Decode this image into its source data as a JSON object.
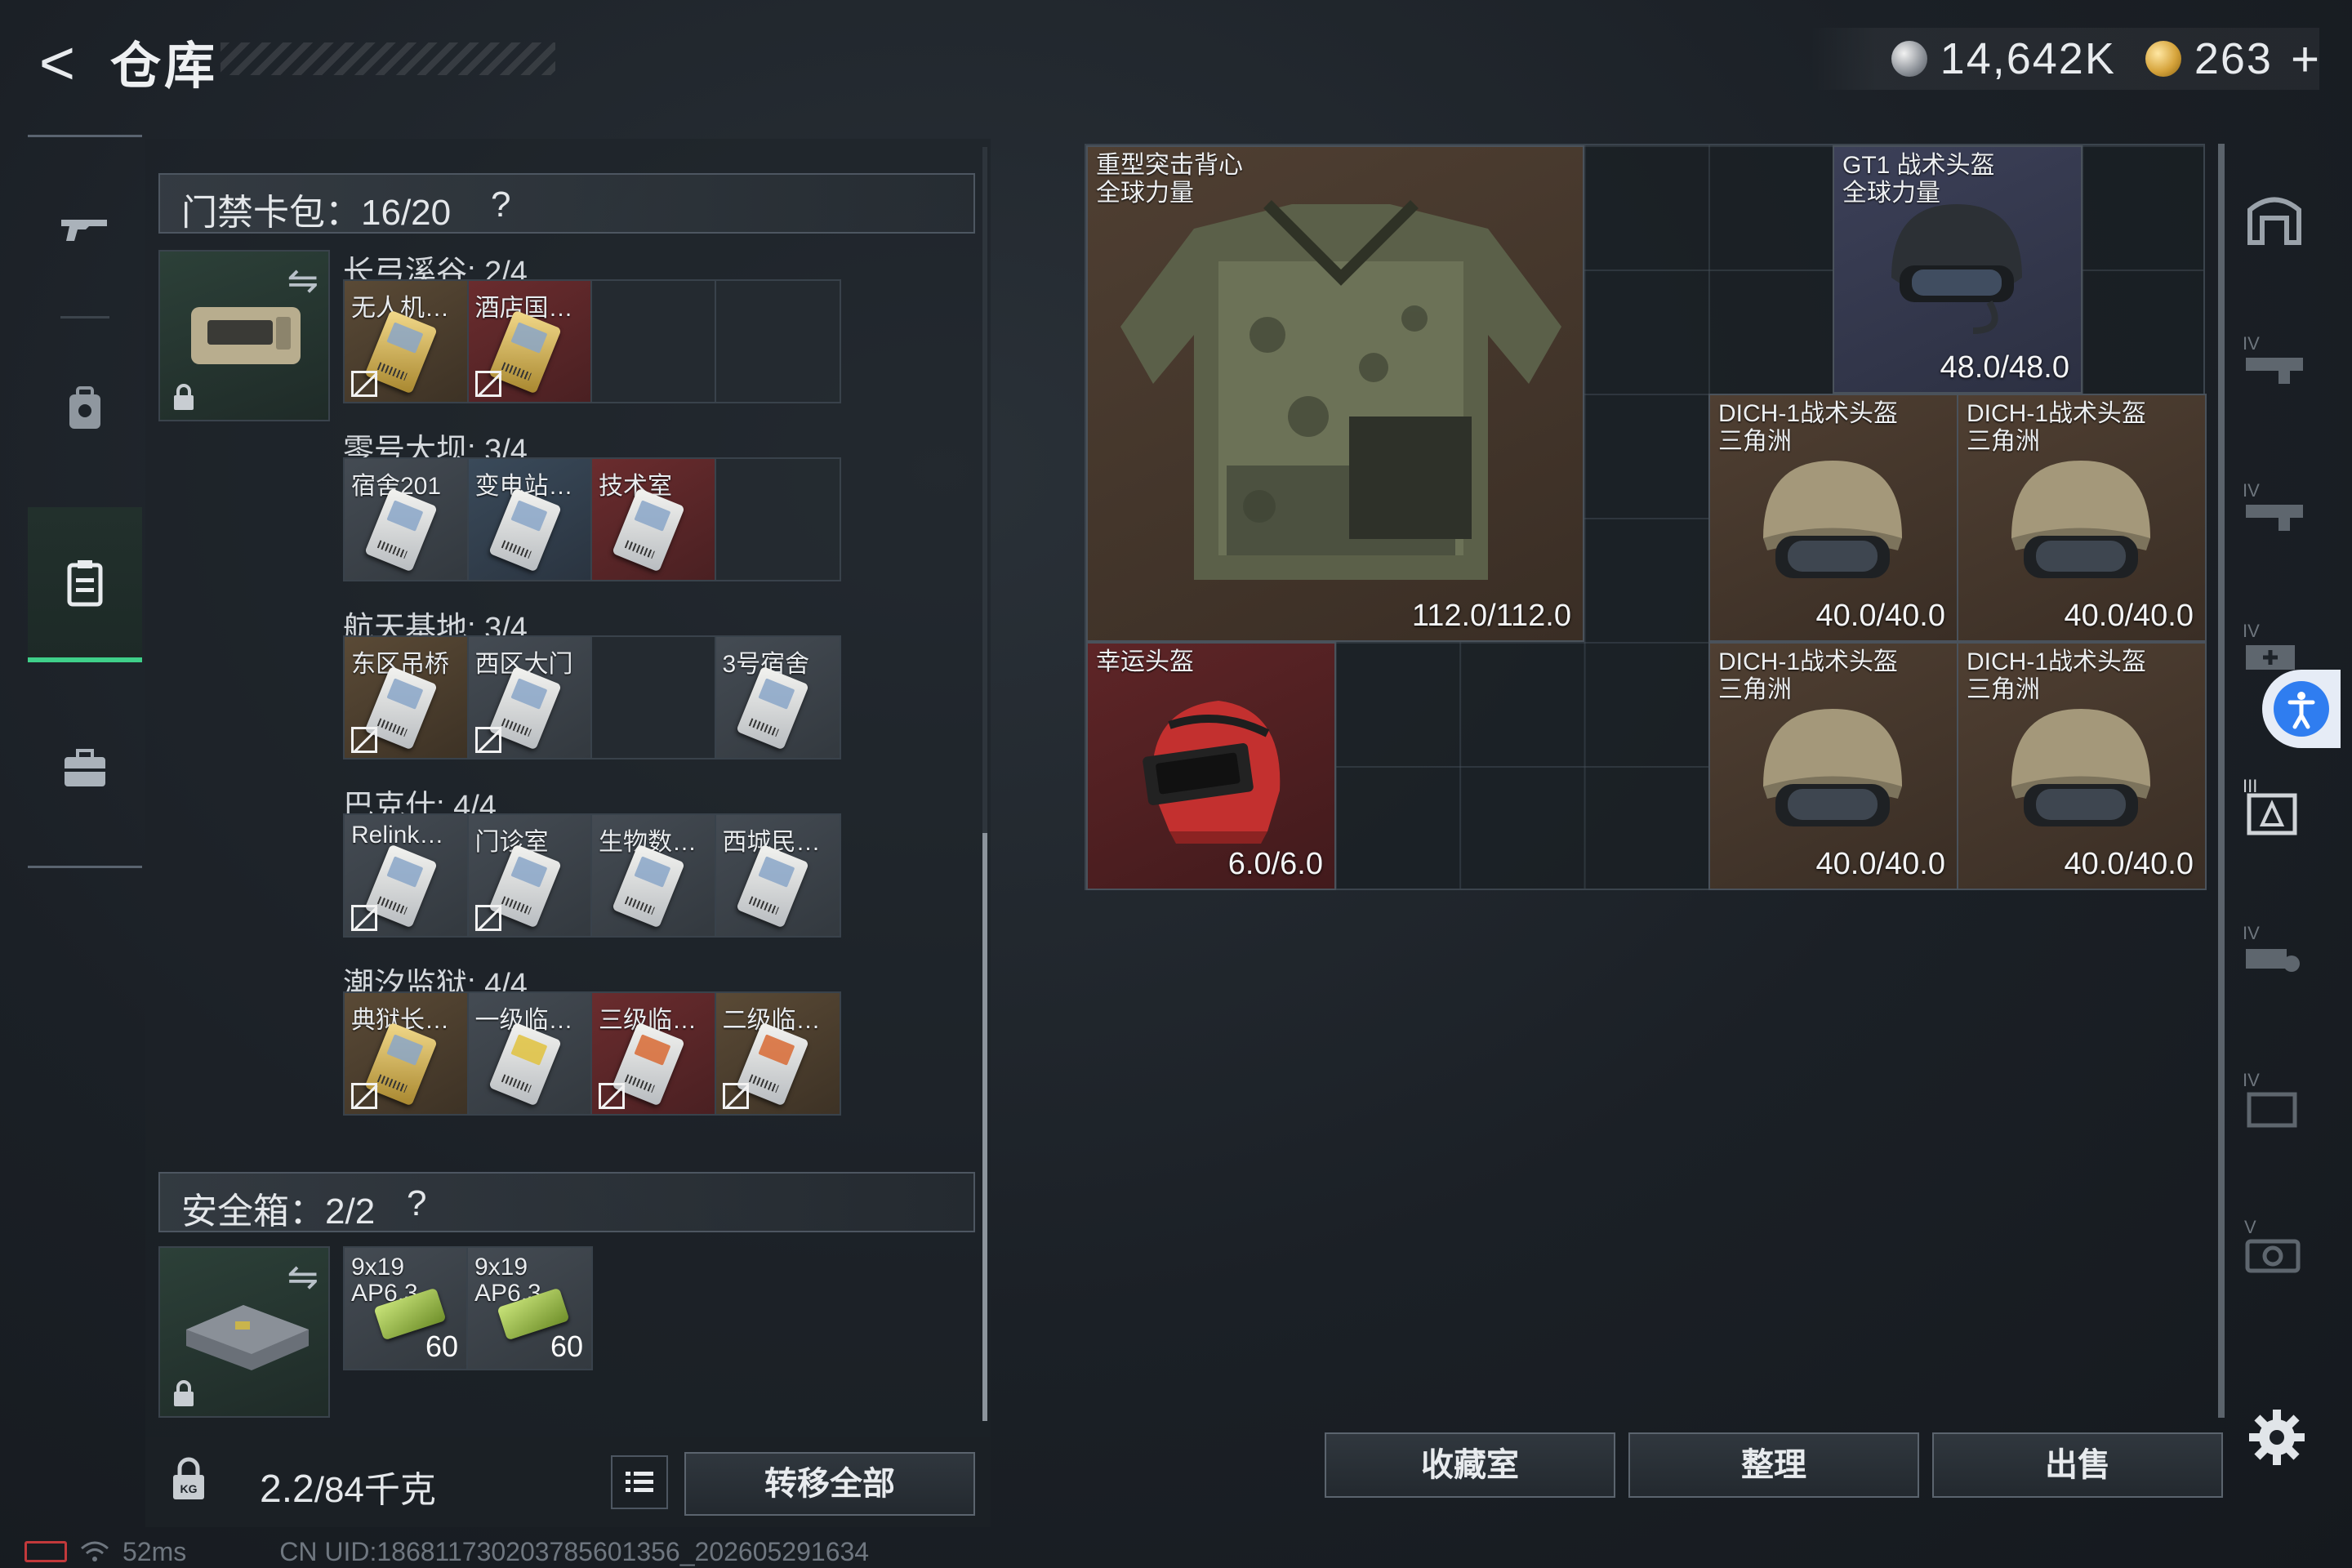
{
  "header": {
    "back_glyph": "<",
    "title": "仓库",
    "currency_silver": "14,642K",
    "currency_gold": "263",
    "add_label": "+"
  },
  "left_nav": {
    "items": [
      {
        "name": "weapons",
        "icon": "gun-icon",
        "active": false
      },
      {
        "name": "backpack",
        "icon": "backpack-icon",
        "active": false
      },
      {
        "name": "storage",
        "icon": "clipboard-icon",
        "active": true
      },
      {
        "name": "case",
        "icon": "briefcase-icon",
        "active": false
      }
    ]
  },
  "keycard_bag": {
    "label": "门禁卡包：16/20",
    "help": "?",
    "swap_icon": "swap-icon",
    "groups": [
      {
        "title": "长弓溪谷: 2/4",
        "cards": [
          {
            "label": "无人机…",
            "color": "gold",
            "key": "gold",
            "unbound": true
          },
          {
            "label": "酒店国…",
            "color": "red",
            "key": "gold",
            "unbound": true
          },
          {
            "label": "",
            "color": "empty"
          },
          {
            "label": "",
            "color": "empty"
          }
        ]
      },
      {
        "title": "零号大坝: 3/4",
        "cards": [
          {
            "label": "宿舍201",
            "color": "grey",
            "key": "white",
            "unbound": false
          },
          {
            "label": "变电站…",
            "color": "blue",
            "key": "white",
            "unbound": false
          },
          {
            "label": "技术室",
            "color": "red",
            "key": "white",
            "unbound": false
          },
          {
            "label": "",
            "color": "empty"
          }
        ]
      },
      {
        "title": "航天基地: 3/4",
        "cards": [
          {
            "label": "东区吊桥",
            "color": "gold",
            "key": "white",
            "unbound": true
          },
          {
            "label": "西区大门",
            "color": "grey",
            "key": "white",
            "unbound": true
          },
          {
            "label": "",
            "color": "empty"
          },
          {
            "label": "3号宿舍",
            "color": "grey",
            "key": "white",
            "unbound": false
          }
        ]
      },
      {
        "title": "巴克什: 4/4",
        "cards": [
          {
            "label": "Relink…",
            "color": "grey",
            "key": "white",
            "unbound": true
          },
          {
            "label": "门诊室",
            "color": "grey",
            "key": "white",
            "unbound": true
          },
          {
            "label": "生物数…",
            "color": "grey",
            "key": "white",
            "unbound": false
          },
          {
            "label": "西城民…",
            "color": "grey",
            "key": "white",
            "unbound": false
          }
        ]
      },
      {
        "title": "潮汐监狱: 4/4",
        "cards": [
          {
            "label": "典狱长…",
            "color": "gold",
            "key": "gold",
            "unbound": true
          },
          {
            "label": "一级临…",
            "color": "grey",
            "key": "yellow",
            "unbound": false
          },
          {
            "label": "三级临…",
            "color": "red",
            "key": "orange",
            "unbound": true
          },
          {
            "label": "二级临…",
            "color": "gold",
            "key": "orange",
            "unbound": true
          }
        ]
      }
    ]
  },
  "safe_box": {
    "label": "安全箱：2/2",
    "help": "?",
    "items": [
      {
        "label": "9x19 AP6.3",
        "qty": "60"
      },
      {
        "label": "9x19 AP6.3",
        "qty": "60"
      }
    ]
  },
  "bottom_left": {
    "weight_current": "2.2",
    "weight_max": "/84千克",
    "transfer_label": "转移全部"
  },
  "inventory": {
    "items": [
      {
        "name": "重型突击背心\n全球力量",
        "durability": "112.0/112.0",
        "rarity": "brown",
        "icon": "vest-icon"
      },
      {
        "name": "GT1 战术头盔\n全球力量",
        "durability": "48.0/48.0",
        "rarity": "purple",
        "icon": "helmet-icon"
      },
      {
        "name": "DICH-1战术头盔\n三角洲",
        "durability": "40.0/40.0",
        "rarity": "brown",
        "icon": "helmet-icon"
      },
      {
        "name": "DICH-1战术头盔\n三角洲",
        "durability": "40.0/40.0",
        "rarity": "brown",
        "icon": "helmet-icon"
      },
      {
        "name": "幸运头盔",
        "durability": "6.0/6.0",
        "rarity": "red",
        "icon": "red-helmet-icon"
      },
      {
        "name": "DICH-1战术头盔\n三角洲",
        "durability": "40.0/40.0",
        "rarity": "brown",
        "icon": "helmet-icon"
      },
      {
        "name": "DICH-1战术头盔\n三角洲",
        "durability": "40.0/40.0",
        "rarity": "brown",
        "icon": "helmet-icon"
      }
    ]
  },
  "actions": {
    "collection": "收藏室",
    "sort": "整理",
    "sell": "出售"
  },
  "status_bar": {
    "ping": "52ms",
    "uid": "CN UID:18681173020378560​1356_202605291634"
  },
  "colors": {
    "accent_green": "#3fd08a",
    "rarity_brown": "#4f3f32",
    "rarity_purple": "#3c4058",
    "rarity_red": "#5e2527",
    "access_blue": "#2f7df0"
  }
}
